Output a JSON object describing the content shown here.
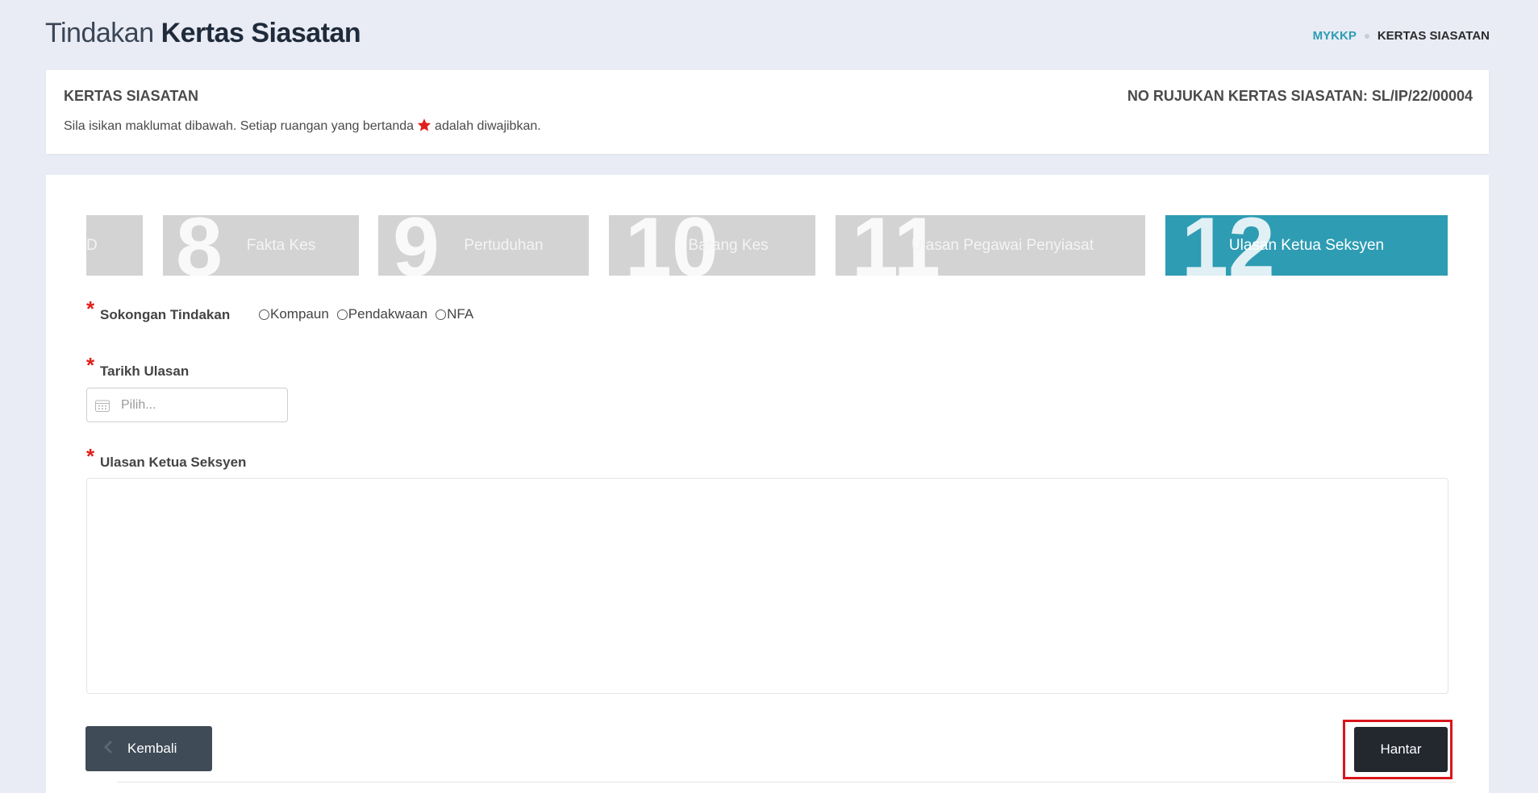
{
  "header": {
    "title_light": "Tindakan",
    "title_bold": "Kertas Siasatan",
    "breadcrumb": [
      "MYKKP",
      "KERTAS SIASATAN"
    ]
  },
  "info": {
    "title": "KERTAS SIASATAN",
    "reference": "NO RUJUKAN KERTAS SIASATAN: SL/IP/22/00004",
    "instruction_before": "Sila isikan maklumat dibawah. Setiap ruangan yang bertanda",
    "instruction_after": "adalah diwajibkan."
  },
  "steps": [
    {
      "num": "",
      "label": "D"
    },
    {
      "num": "8",
      "label": "Fakta Kes"
    },
    {
      "num": "9",
      "label": "Pertuduhan"
    },
    {
      "num": "10",
      "label": "Barang Kes"
    },
    {
      "num": "11",
      "label": "Ulasan Pegawai Penyiasat"
    },
    {
      "num": "12",
      "label": "Ulasan Ketua Seksyen",
      "active": true
    }
  ],
  "form": {
    "required_mark": "*",
    "action_label": "Sokongan Tindakan",
    "action_options": [
      "Kompaun",
      "Pendakwaan",
      "NFA"
    ],
    "date_label": "Tarikh Ulasan",
    "date_placeholder": "Pilih...",
    "comment_label": "Ulasan Ketua Seksyen",
    "comment_value": ""
  },
  "buttons": {
    "back": "Kembali",
    "submit": "Hantar"
  },
  "colors": {
    "accent": "#2e9cb3",
    "required": "#e0201b",
    "submit_bg": "#23272e",
    "back_bg": "#3f4b56",
    "highlight": "#d9161b"
  },
  "icons": {
    "back": "chevron-left-icon",
    "date": "calendar-icon",
    "required": "star-icon"
  }
}
